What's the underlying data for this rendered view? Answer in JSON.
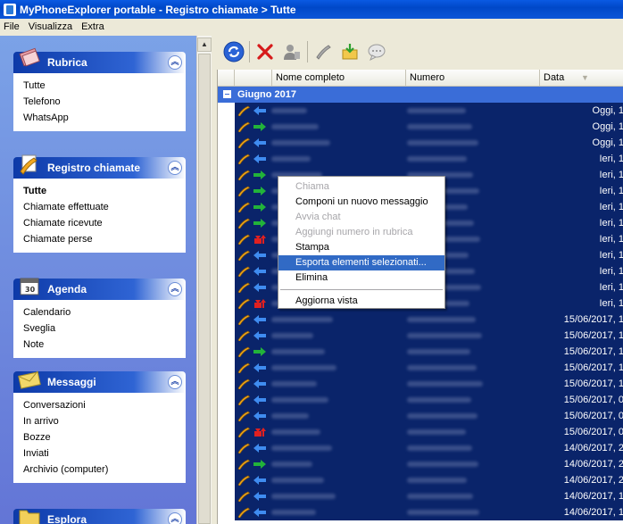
{
  "window": {
    "title": "MyPhoneExplorer portable - Registro chiamate > Tutte"
  },
  "menu": [
    "File",
    "Visualizza",
    "Extra"
  ],
  "sidebar": {
    "panels": [
      {
        "title": "Rubrica",
        "icon": "address-book-icon",
        "items": [
          "Tutte",
          "Telefono",
          "WhatsApp"
        ],
        "active": -1
      },
      {
        "title": "Registro chiamate",
        "icon": "phone-log-icon",
        "items": [
          "Tutte",
          "Chiamate effettuate",
          "Chiamate ricevute",
          "Chiamate perse"
        ],
        "active": 0
      },
      {
        "title": "Agenda",
        "icon": "calendar-icon",
        "items": [
          "Calendario",
          "Sveglia",
          "Note"
        ],
        "active": -1
      },
      {
        "title": "Messaggi",
        "icon": "envelope-icon",
        "items": [
          "Conversazioni",
          "In arrivo",
          "Bozze",
          "Inviati",
          "Archivio (computer)"
        ],
        "active": -1
      },
      {
        "title": "Esplora",
        "icon": "folder-icon",
        "items": [],
        "active": -1
      }
    ]
  },
  "toolbar": {
    "buttons": [
      "refresh-icon",
      "delete-icon",
      "contact-icon",
      "phone-icon",
      "export-icon",
      "message-icon"
    ]
  },
  "grid": {
    "columns": [
      "Nome completo",
      "Numero",
      "Data"
    ],
    "group": "Giugno 2017",
    "rows": [
      {
        "type": "in",
        "date": "Oggi, 1"
      },
      {
        "type": "out",
        "date": "Oggi, 1"
      },
      {
        "type": "in",
        "date": "Oggi, 1"
      },
      {
        "type": "in",
        "date": "Ieri, 1"
      },
      {
        "type": "out",
        "date": "Ieri, 1"
      },
      {
        "type": "out",
        "date": "Ieri, 1"
      },
      {
        "type": "out",
        "date": "Ieri, 1"
      },
      {
        "type": "out",
        "date": "Ieri, 1"
      },
      {
        "type": "missed",
        "date": "Ieri, 1"
      },
      {
        "type": "in",
        "date": "Ieri, 1"
      },
      {
        "type": "in",
        "date": "Ieri, 1"
      },
      {
        "type": "in",
        "date": "Ieri, 1"
      },
      {
        "type": "missed",
        "date": "Ieri, 1"
      },
      {
        "type": "in",
        "date": "15/06/2017, 1"
      },
      {
        "type": "in",
        "date": "15/06/2017, 1"
      },
      {
        "type": "out",
        "date": "15/06/2017, 1"
      },
      {
        "type": "in",
        "date": "15/06/2017, 1"
      },
      {
        "type": "in",
        "date": "15/06/2017, 1"
      },
      {
        "type": "in",
        "date": "15/06/2017, 0"
      },
      {
        "type": "in",
        "date": "15/06/2017, 0"
      },
      {
        "type": "missed",
        "date": "15/06/2017, 0"
      },
      {
        "type": "in",
        "date": "14/06/2017, 2"
      },
      {
        "type": "out",
        "date": "14/06/2017, 2"
      },
      {
        "type": "in",
        "date": "14/06/2017, 2"
      },
      {
        "type": "in",
        "date": "14/06/2017, 1"
      },
      {
        "type": "in",
        "date": "14/06/2017, 1"
      }
    ]
  },
  "context_menu": {
    "items": [
      {
        "label": "Chiama",
        "disabled": true
      },
      {
        "label": "Componi un nuovo messaggio",
        "disabled": false
      },
      {
        "label": "Avvia chat",
        "disabled": true
      },
      {
        "label": "Aggiungi numero in rubrica",
        "disabled": true
      },
      {
        "label": "Stampa",
        "disabled": false
      },
      {
        "label": "Esporta elementi selezionati...",
        "disabled": false,
        "highlighted": true
      },
      {
        "label": "Elimina",
        "disabled": false
      },
      {
        "separator": true
      },
      {
        "label": "Aggiorna vista",
        "disabled": false
      }
    ]
  },
  "colors": {
    "selection": "#0a246a",
    "group_header": "#3a6dd8",
    "menu_highlight": "#316ac5",
    "in_arrow": "#3f8cf0",
    "out_arrow": "#22b33a",
    "missed_arrow": "#e02020"
  }
}
